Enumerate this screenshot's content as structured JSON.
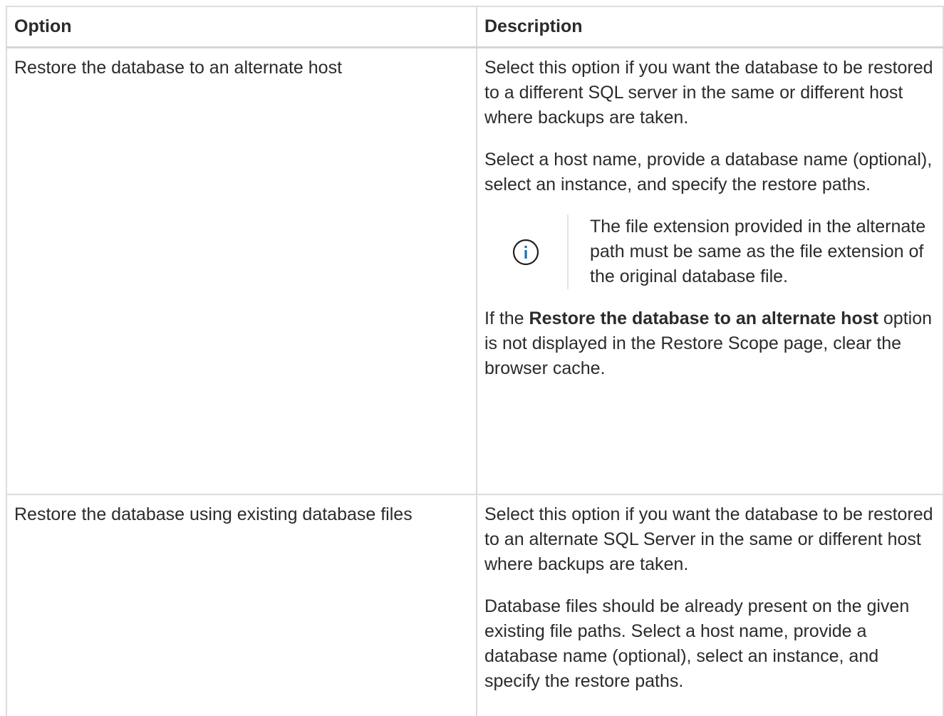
{
  "table": {
    "headers": [
      "Option",
      "Description"
    ],
    "rows": [
      {
        "option": "Restore the database to an alternate host",
        "desc_1": "Select this option if you want the database to be restored to a different SQL server in the same or different host where backups are taken.",
        "desc_2": "Select a host name, provide a database name (optional), select an instance, and specify the restore paths.",
        "note": {
          "icon": "info-icon",
          "text": "The file extension provided in the alternate path must be same as the file extension of the original database file."
        },
        "desc_3_prefix": "If the ",
        "desc_3_bold": "Restore the database to an alternate host",
        "desc_3_suffix": " option is not displayed in the Restore Scope page, clear the browser cache."
      },
      {
        "option": "Restore the database using existing database files",
        "desc_1": "Select this option if you want the database to be restored to an alternate SQL Server in the same or different host where backups are taken.",
        "desc_2": "Database files should be already present on the given existing file paths. Select a host name, provide a database name (optional), select an instance, and specify the restore paths."
      }
    ]
  },
  "colors": {
    "text": "#2b2b2b",
    "border": "#dcdcdc",
    "info_icon": "#1a6fb3"
  }
}
